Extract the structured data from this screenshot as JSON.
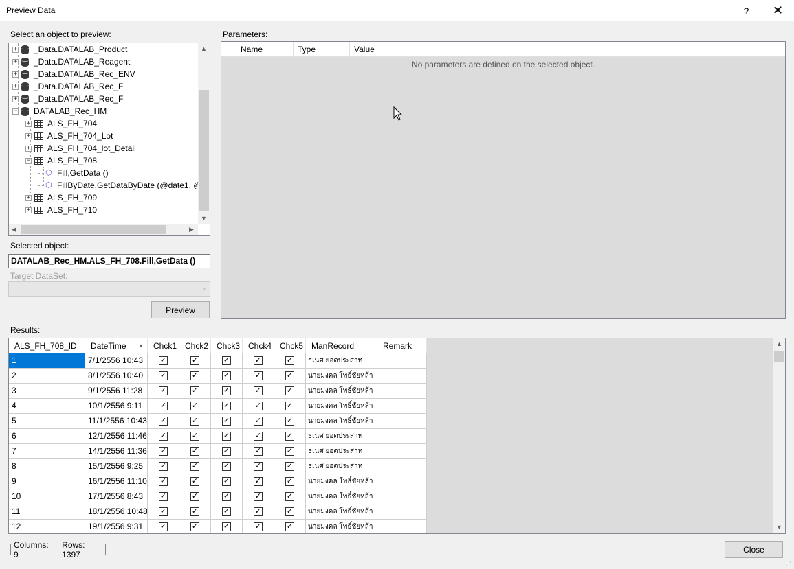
{
  "window": {
    "title": "Preview Data",
    "help": "?",
    "close": "✕"
  },
  "labels": {
    "select_object": "Select an object to preview:",
    "parameters": "Parameters:",
    "selected_object": "Selected object:",
    "target_dataset": "Target DataSet:",
    "results": "Results:"
  },
  "tree": {
    "items": [
      {
        "label": "_Data.DATALAB_Product",
        "kind": "db",
        "expander": "+"
      },
      {
        "label": "_Data.DATALAB_Reagent",
        "kind": "db",
        "expander": "+"
      },
      {
        "label": "_Data.DATALAB_Rec_ENV",
        "kind": "db",
        "expander": "+"
      },
      {
        "label": "_Data.DATALAB_Rec_F",
        "kind": "db",
        "expander": "+"
      },
      {
        "label": "_Data.DATALAB_Rec_F",
        "kind": "db",
        "expander": "+"
      },
      {
        "label": "DATALAB_Rec_HM",
        "kind": "db",
        "expander": "−"
      },
      {
        "label": "ALS_FH_704",
        "kind": "table",
        "expander": "+"
      },
      {
        "label": "ALS_FH_704_Lot",
        "kind": "table",
        "expander": "+"
      },
      {
        "label": "ALS_FH_704_lot_Detail",
        "kind": "table",
        "expander": "+"
      },
      {
        "label": "ALS_FH_708",
        "kind": "table",
        "expander": "−"
      },
      {
        "label": "Fill,GetData ()",
        "kind": "method",
        "expander": ""
      },
      {
        "label": "FillByDate,GetDataByDate (@date1, @",
        "kind": "method",
        "expander": ""
      },
      {
        "label": "ALS_FH_709",
        "kind": "table",
        "expander": "+"
      },
      {
        "label": "ALS_FH_710",
        "kind": "table",
        "expander": "+"
      }
    ]
  },
  "selected_object": {
    "value": "DATALAB_Rec_HM.ALS_FH_708.Fill,GetData ()"
  },
  "preview_button": "Preview",
  "params": {
    "columns": [
      "Name",
      "Type",
      "Value"
    ],
    "empty_message": "No parameters are defined on the selected object."
  },
  "results": {
    "columns": [
      "ALS_FH_708_ID",
      "DateTime",
      "Chck1",
      "Chck2",
      "Chck3",
      "Chck4",
      "Chck5",
      "ManRecord",
      "Remark"
    ],
    "rows": [
      {
        "id": "1",
        "datetime": "7/1/2556 10:43",
        "man": "ธเนศ ยอดประสาท",
        "remark": ""
      },
      {
        "id": "2",
        "datetime": "8/1/2556 10:40",
        "man": "นายมงคล โพธิ์ชัยหล้า",
        "remark": ""
      },
      {
        "id": "3",
        "datetime": "9/1/2556 11:28",
        "man": "นายมงคล โพธิ์ชัยหล้า",
        "remark": ""
      },
      {
        "id": "4",
        "datetime": "10/1/2556 9:11",
        "man": "นายมงคล โพธิ์ชัยหล้า",
        "remark": ""
      },
      {
        "id": "5",
        "datetime": "11/1/2556 10:43",
        "man": "นายมงคล โพธิ์ชัยหล้า",
        "remark": ""
      },
      {
        "id": "6",
        "datetime": "12/1/2556 11:46",
        "man": "ธเนศ ยอดประสาท",
        "remark": ""
      },
      {
        "id": "7",
        "datetime": "14/1/2556 11:36",
        "man": "ธเนศ ยอดประสาท",
        "remark": ""
      },
      {
        "id": "8",
        "datetime": "15/1/2556 9:25",
        "man": "ธเนศ ยอดประสาท",
        "remark": ""
      },
      {
        "id": "9",
        "datetime": "16/1/2556 11:10",
        "man": "นายมงคล โพธิ์ชัยหล้า",
        "remark": ""
      },
      {
        "id": "10",
        "datetime": "17/1/2556 8:43",
        "man": "นายมงคล โพธิ์ชัยหล้า",
        "remark": ""
      },
      {
        "id": "11",
        "datetime": "18/1/2556 10:48",
        "man": "นายมงคล โพธิ์ชัยหล้า",
        "remark": ""
      },
      {
        "id": "12",
        "datetime": "19/1/2556 9:31",
        "man": "นายมงคล โพธิ์ชัยหล้า",
        "remark": ""
      }
    ]
  },
  "status": {
    "columns": "Columns: 9",
    "rows": "Rows: 1397"
  },
  "close_button": "Close",
  "colors": {
    "selection": "#0078d7",
    "window_bg": "#f0f0f0",
    "grid_bg": "#dcdcdc"
  }
}
